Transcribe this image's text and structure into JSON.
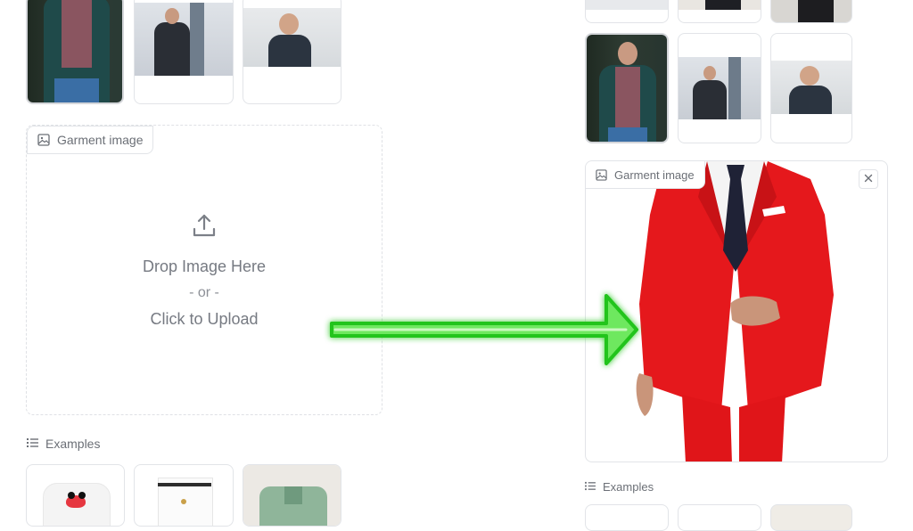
{
  "left": {
    "garment_label": "Garment image",
    "upload": {
      "drop_text": "Drop Image Here",
      "or_text": "- or -",
      "click_text": "Click to Upload"
    },
    "examples_label": "Examples"
  },
  "right": {
    "garment_label": "Garment image",
    "examples_label": "Examples"
  },
  "icons": {
    "image": "image-icon",
    "upload": "upload-icon",
    "list": "list-icon",
    "close": "close-icon",
    "arrow": "arrow-right-icon"
  },
  "colors": {
    "suit": "#e5181c",
    "arrow": "#35d42a",
    "border": "#e2e4e8"
  }
}
